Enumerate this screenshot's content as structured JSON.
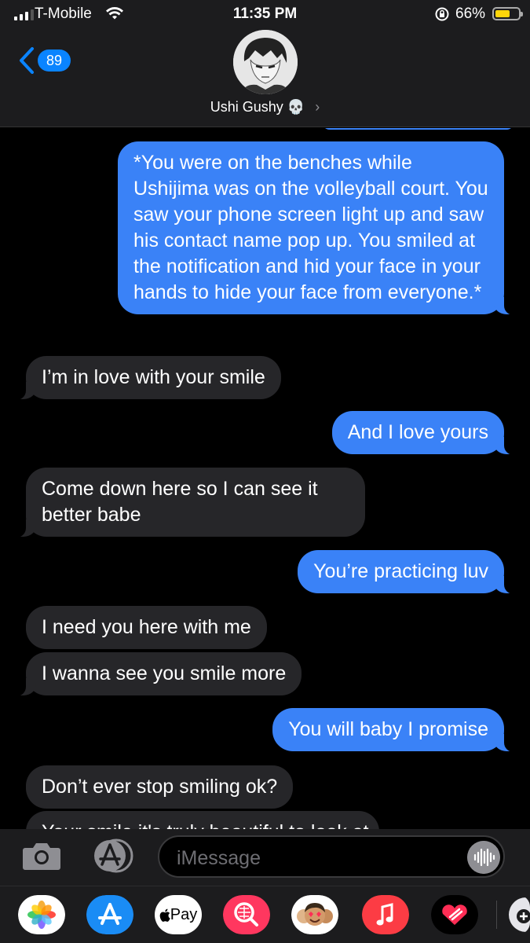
{
  "status_bar": {
    "carrier": "T-Mobile",
    "time": "11:35 PM",
    "battery_percent": "66%",
    "battery_level": 0.66
  },
  "header": {
    "back_count": "89",
    "contact_name": "Ushi Gushy",
    "contact_emoji": "💀",
    "chevron": "›"
  },
  "messages": [
    {
      "dir": "out",
      "text": "*You were on the benches while Ushijima was on the volleyball court. You saw your phone screen light up and saw his contact name pop up. You smiled at the notification and hid your face in your hands to hide your face from everyone.*"
    },
    {
      "dir": "in",
      "text": "I’m in love with your smile"
    },
    {
      "dir": "out",
      "text": "And I love yours"
    },
    {
      "dir": "in",
      "text": "Come down here so I can see it better babe"
    },
    {
      "dir": "out",
      "text": "You’re practicing luv"
    },
    {
      "dir": "in",
      "text": "I need you here with me"
    },
    {
      "dir": "in",
      "text": "I wanna see you smile more"
    },
    {
      "dir": "out",
      "text": "You will baby I promise"
    },
    {
      "dir": "in",
      "text": "Don’t ever stop smiling ok?"
    },
    {
      "dir": "in",
      "text": "Your smile it's truly beautiful to look at"
    }
  ],
  "input": {
    "placeholder": "iMessage"
  },
  "app_strip": {
    "apple_pay_label": "Pay",
    "icons": [
      "photos-icon",
      "app-store-icon",
      "apple-pay-icon",
      "search-images-icon",
      "memoji-icon",
      "music-icon",
      "digital-touch-icon",
      "more-apps-icon"
    ]
  },
  "colors": {
    "outgoing_bubble": "#3a82f7",
    "incoming_bubble": "#262629",
    "accent": "#0a84ff",
    "battery": "#ffd60a"
  }
}
